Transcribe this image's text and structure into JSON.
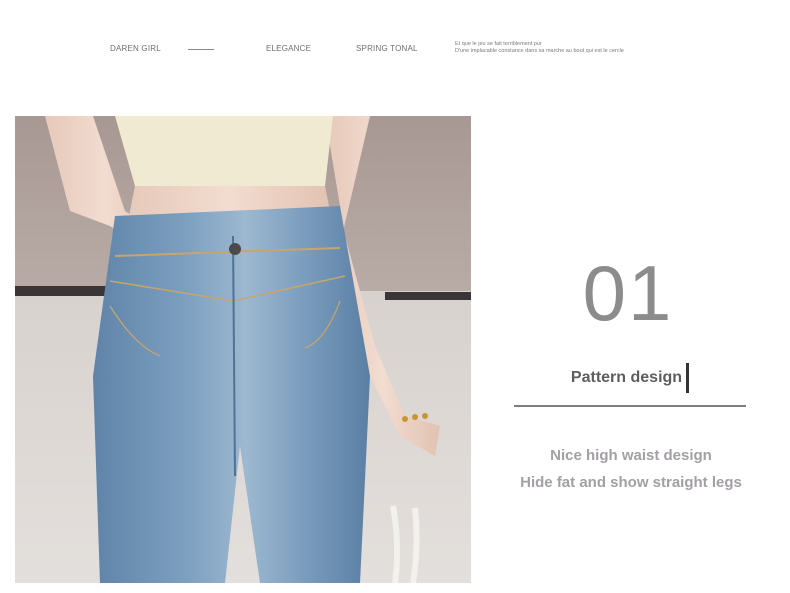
{
  "top_bar": {
    "brand": "DAREN GIRL",
    "elegance": "ELEGANCE",
    "spring": "SPRING TONAL",
    "slogan_line1": "Et que le jeu se fait terriblement pur",
    "slogan_line2": "D'une implacable constance dans sa marche au bout qui est le cercle"
  },
  "product_photo": {
    "subject": "high-waist light blue jeans with cream crop top"
  },
  "feature": {
    "number": "01",
    "title": "Pattern design",
    "line1": "Nice high waist design",
    "line2": "Hide fat and show straight legs"
  },
  "colors": {
    "number": "#8c8c8c",
    "title": "#5e5e5e",
    "description": "#a39fa4",
    "divider": "#7e7e7e",
    "denim": "#6f93b6"
  }
}
